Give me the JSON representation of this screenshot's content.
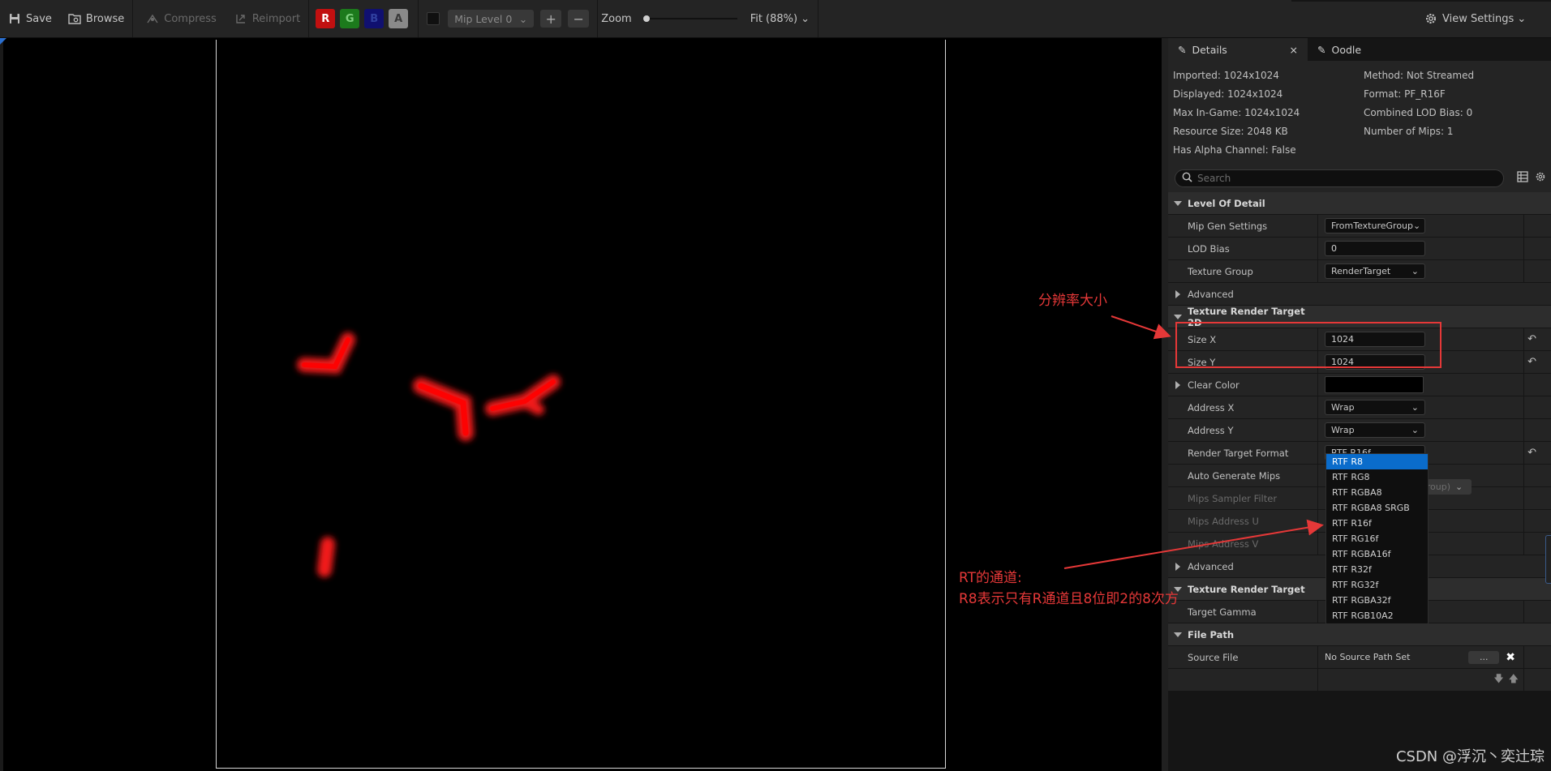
{
  "toolbar": {
    "save": "Save",
    "browse": "Browse",
    "compress": "Compress",
    "reimport": "Reimport",
    "channels": [
      {
        "label": "R",
        "bg": "#c11010",
        "fg": "#ffffff"
      },
      {
        "label": "G",
        "bg": "#1c7a1c",
        "fg": "#7fd07f"
      },
      {
        "label": "B",
        "bg": "#101070",
        "fg": "#3040a0"
      },
      {
        "label": "A",
        "bg": "#8a8a8a",
        "fg": "#3a3a3a"
      }
    ],
    "mip_level": "Mip Level 0",
    "zoom_label": "Zoom",
    "fit": "Fit (88%)",
    "view_settings": "View Settings"
  },
  "tabs": {
    "details": "Details",
    "oodle": "Oodle"
  },
  "info": {
    "left": [
      "Imported: 1024x1024",
      "Displayed: 1024x1024",
      "Max In-Game: 1024x1024",
      "Resource Size: 2048 KB",
      "Has Alpha Channel: False"
    ],
    "right": [
      "Method: Not Streamed",
      "Format: PF_R16F",
      "Combined LOD Bias: 0",
      "Number of Mips: 1"
    ]
  },
  "search": {
    "placeholder": "Search"
  },
  "properties": {
    "lod_category": "Level Of Detail",
    "mip_gen_settings": {
      "name": "Mip Gen Settings",
      "value": "FromTextureGroup"
    },
    "lod_bias": {
      "name": "LOD Bias",
      "value": "0"
    },
    "texture_group": {
      "name": "Texture Group",
      "value": "RenderTarget"
    },
    "advanced_1": "Advanced",
    "rt2d_category": "Texture Render Target 2D",
    "size_x": {
      "name": "Size X",
      "value": "1024"
    },
    "size_y": {
      "name": "Size Y",
      "value": "1024"
    },
    "clear_color": {
      "name": "Clear Color"
    },
    "address_x": {
      "name": "Address X",
      "value": "Wrap"
    },
    "address_y": {
      "name": "Address Y",
      "value": "Wrap"
    },
    "rt_format": {
      "name": "Render Target Format",
      "value": "RTF R16f"
    },
    "auto_gen_mips": {
      "name": "Auto Generate Mips"
    },
    "mips_sampler_filter": {
      "name": "Mips Sampler Filter",
      "partial_value": "roup)"
    },
    "mips_address_u": {
      "name": "Mips Address U"
    },
    "mips_address_v": {
      "name": "Mips Address V"
    },
    "advanced_2": "Advanced",
    "rt_category": "Texture Render Target",
    "target_gamma": {
      "name": "Target Gamma"
    },
    "file_path_category": "File Path",
    "source_file": {
      "name": "Source File",
      "value": "No Source Path Set",
      "browse": "..."
    }
  },
  "format_options": [
    "RTF R8",
    "RTF RG8",
    "RTF RGBA8",
    "RTF RGBA8 SRGB",
    "RTF R16f",
    "RTF RG16f",
    "RTF RGBA16f",
    "RTF R32f",
    "RTF RG32f",
    "RTF RGBA32f",
    "RTF RGB10A2"
  ],
  "annotations": {
    "resolution": "分辨率大小",
    "channel_line1": "RT的通道:",
    "channel_line2": "R8表示只有R通道且8位即2的8次方"
  },
  "watermark": "CSDN @浮沉丶奕辻琮",
  "colors": {
    "accent_red": "#e53838",
    "selection_blue": "#0a6ccb",
    "glow_red": "#ff1a1a"
  }
}
